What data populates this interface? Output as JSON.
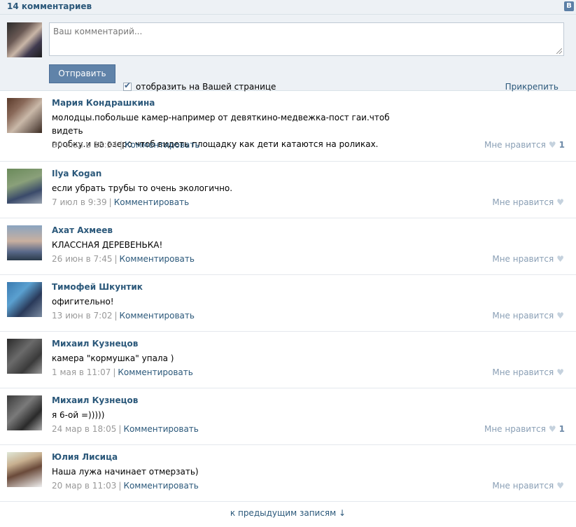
{
  "header": {
    "count_label": "14 комментариев",
    "vk_logo": "В"
  },
  "composer": {
    "placeholder": "Ваш комментарий...",
    "send_label": "Отправить",
    "checkbox_label": "отобразить на Вашей странице",
    "checkbox_checked": true,
    "attach_label": "Прикрепить"
  },
  "comments": [
    {
      "name": "Мария Кондрашкина",
      "text": [
        "молодцы.побольше камер-например от девяткино-медвежка-пост гаи.чтоб видеть",
        "пробку.и на озеро чтоб видеть площадку как дети катаются на роликах."
      ],
      "date": "30 июл в 18:34",
      "reply": "Комментировать",
      "like": "Мне нравится",
      "likes": "1"
    },
    {
      "name": "Ilya Kogan",
      "text": [
        "если убрать трубы то очень экологично."
      ],
      "date": "7 июл в 9:39",
      "reply": "Комментировать",
      "like": "Мне нравится",
      "likes": ""
    },
    {
      "name": "Ахат Ахмеев",
      "text": [
        "КЛАССНАЯ ДЕРЕВЕНЬКА!"
      ],
      "date": "26 июн в 7:45",
      "reply": "Комментировать",
      "like": "Мне нравится",
      "likes": ""
    },
    {
      "name": "Тимофей Шкунтик",
      "text": [
        "офигительно!"
      ],
      "date": "13 июн в 7:02",
      "reply": "Комментировать",
      "like": "Мне нравится",
      "likes": ""
    },
    {
      "name": "Михаил Кузнецов",
      "text": [
        "камера \"кормушка\" упала )"
      ],
      "date": "1 мая в 11:07",
      "reply": "Комментировать",
      "like": "Мне нравится",
      "likes": ""
    },
    {
      "name": "Михаил Кузнецов",
      "text": [
        "я 6-ой =)))))"
      ],
      "date": "24 мар в 18:05",
      "reply": "Комментировать",
      "like": "Мне нравится",
      "likes": "1"
    },
    {
      "name": "Юлия Лисица",
      "text": [
        "Наша лужа начинает отмерзать)"
      ],
      "date": "20 мар в 11:03",
      "reply": "Комментировать",
      "like": "Мне нравится",
      "likes": ""
    }
  ],
  "footer": {
    "more_label": "к предыдущим записям ↓"
  }
}
